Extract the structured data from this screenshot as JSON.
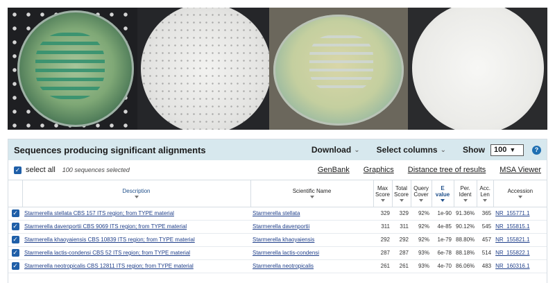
{
  "images": [
    {
      "alt": "green agar plate with zigzag streak"
    },
    {
      "alt": "microscopy field with cells"
    },
    {
      "alt": "pale agar plate with streak"
    },
    {
      "alt": "microscopy field"
    }
  ],
  "panel": {
    "title": "Sequences producing significant alignments",
    "download_label": "Download",
    "select_columns_label": "Select columns",
    "show_label": "Show",
    "show_value": "100",
    "help": "?"
  },
  "toolbar": {
    "select_all": "select all",
    "selected_count": "100 sequences selected",
    "links": [
      "GenBank",
      "Graphics",
      "Distance tree of results",
      "MSA Viewer"
    ]
  },
  "table": {
    "headers": {
      "description": "Description",
      "scientific_name": "Scientific Name",
      "max_score": [
        "Max",
        "Score"
      ],
      "total_score": [
        "Total",
        "Score"
      ],
      "query_cover": [
        "Query",
        "Cover"
      ],
      "e_value": [
        "E",
        "value"
      ],
      "per_ident": [
        "Per.",
        "Ident"
      ],
      "acc_len": [
        "Acc.",
        "Len"
      ],
      "accession": "Accession"
    },
    "rows": [
      {
        "description": "Starmerella stellata CBS 157 ITS region; from TYPE material",
        "scientific_name": "Starmerella stellata",
        "max_score": "329",
        "total_score": "329",
        "query_cover": "92%",
        "e_value": "1e-90",
        "per_ident": "91.36%",
        "acc_len": "365",
        "accession": "NR_155771.1"
      },
      {
        "description": "Starmerella davenportii CBS 9069 ITS region; from TYPE material",
        "scientific_name": "Starmerella davenportii",
        "max_score": "311",
        "total_score": "311",
        "query_cover": "92%",
        "e_value": "4e-85",
        "per_ident": "90.12%",
        "acc_len": "545",
        "accession": "NR_155815.1"
      },
      {
        "description": "Starmerella khaoyaiensis CBS 10839 ITS region; from TYPE material",
        "scientific_name": "Starmerella khaoyaiensis",
        "max_score": "292",
        "total_score": "292",
        "query_cover": "92%",
        "e_value": "1e-79",
        "per_ident": "88.80%",
        "acc_len": "457",
        "accession": "NR_155821.1"
      },
      {
        "description": "Starmerella lactis-condensi CBS 52 ITS region; from TYPE material",
        "scientific_name": "Starmerella lactis-condensi",
        "max_score": "287",
        "total_score": "287",
        "query_cover": "93%",
        "e_value": "6e-78",
        "per_ident": "88.18%",
        "acc_len": "514",
        "accession": "NR_155822.1"
      },
      {
        "description": "Starmerella neotropicalis CBS 12811 ITS region; from TYPE material",
        "scientific_name": "Starmerella neotropicalis",
        "max_score": "261",
        "total_score": "261",
        "query_cover": "93%",
        "e_value": "4e-70",
        "per_ident": "86.06%",
        "acc_len": "483",
        "accession": "NR_160316.1"
      }
    ]
  },
  "colors": {
    "header_bg": "#d7e8ee",
    "checkbox": "#1f5fa8",
    "link": "#1f3f8a"
  }
}
